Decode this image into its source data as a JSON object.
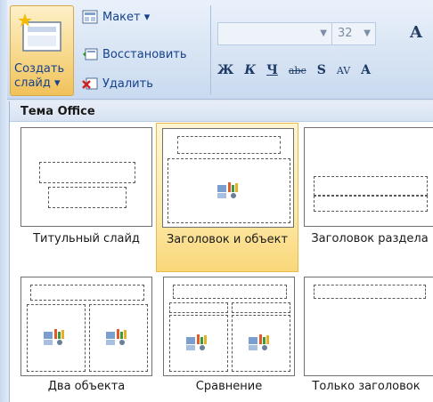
{
  "ribbon": {
    "new_slide": {
      "line1": "Создать",
      "line2": "слайд ▾",
      "icon": "new-slide-icon"
    },
    "layout_btn": {
      "label": "Макет ▾",
      "icon": "layout-icon"
    },
    "reset_btn": {
      "label": "Восстановить",
      "icon": "reset-icon"
    },
    "delete_btn": {
      "label": "Удалить",
      "icon": "delete-icon"
    },
    "font_name": "",
    "font_size": "32",
    "grow_font": "A",
    "format_buttons": [
      "Ж",
      "К",
      "Ч",
      "abc",
      "S",
      "AV",
      "A"
    ]
  },
  "gallery": {
    "header": "Тема Office",
    "layouts": [
      {
        "label": "Титульный слайд",
        "selected": false
      },
      {
        "label": "Заголовок и объект",
        "selected": true
      },
      {
        "label": "Заголовок раздела",
        "selected": false
      },
      {
        "label": "Два объекта",
        "selected": false
      },
      {
        "label": "Сравнение",
        "selected": false
      },
      {
        "label": "Только заголовок",
        "selected": false
      }
    ]
  },
  "colors": {
    "accent": "#f9d77a",
    "ribbon": "#d6e3f3",
    "text_blue": "#15428b"
  }
}
